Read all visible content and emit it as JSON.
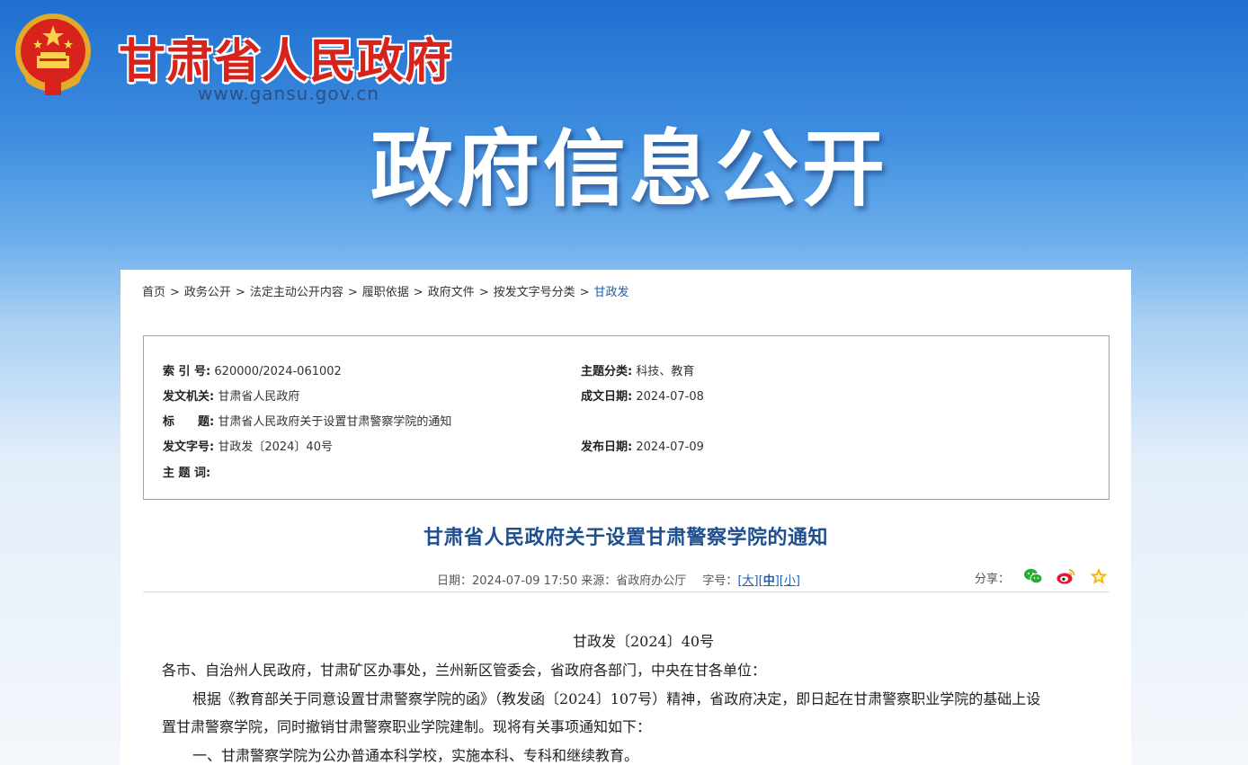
{
  "header": {
    "site_name": "甘肃省人民政府",
    "site_url": "www.gansu.gov.cn",
    "banner_title": "政府信息公开"
  },
  "breadcrumb": [
    "首页",
    "政务公开",
    "法定主动公开内容",
    "履职依据",
    "政府文件",
    "按发文字号分类",
    "甘政发"
  ],
  "meta": {
    "index_label": "索 引 号:",
    "index_value": "620000/2024-061002",
    "topic_label": "主题分类:",
    "topic_value": "科技、教育",
    "issuer_label": "发文机关:",
    "issuer_value": "甘肃省人民政府",
    "created_label": "成文日期:",
    "created_value": "2024-07-08",
    "title_label": "标　　题:",
    "title_value": "甘肃省人民政府关于设置甘肃警察学院的通知",
    "docno_label": "发文字号:",
    "docno_value": "甘政发〔2024〕40号",
    "published_label": "发布日期:",
    "published_value": "2024-07-09",
    "keywords_label": "主 题 词:",
    "keywords_value": ""
  },
  "article": {
    "title": "甘肃省人民政府关于设置甘肃警察学院的通知",
    "date_text": "日期：2024-07-09 17:50 来源：省政府办公厅",
    "fontsize_label": "字号：",
    "font_large": "大",
    "font_medium": "中",
    "font_small": "小",
    "share_label": "分享：",
    "doc_number": "甘政发〔2024〕40号",
    "salutation": "各市、自治州人民政府，甘肃矿区办事处，兰州新区管委会，省政府各部门，中央在甘各单位：",
    "para1_line1": "根据《教育部关于同意设置甘肃警察学院的函》（教发函〔2024〕107号）精神，省政府决定，即日起在甘肃警察职业学院的基础上设",
    "para1_line2": "置甘肃警察学院，同时撤销甘肃警察职业学院建制。现将有关事项通知如下：",
    "item1": "一、甘肃警察学院为公办普通本科学校，实施本科、专科和继续教育。"
  },
  "icons": {
    "emblem": "national-emblem-icon",
    "wechat": "wechat-icon",
    "weibo": "weibo-icon",
    "favorite": "star-icon"
  },
  "colors": {
    "site_name": "#d8231c",
    "article_title": "#1e4f8e",
    "link": "#1a5fb4"
  }
}
